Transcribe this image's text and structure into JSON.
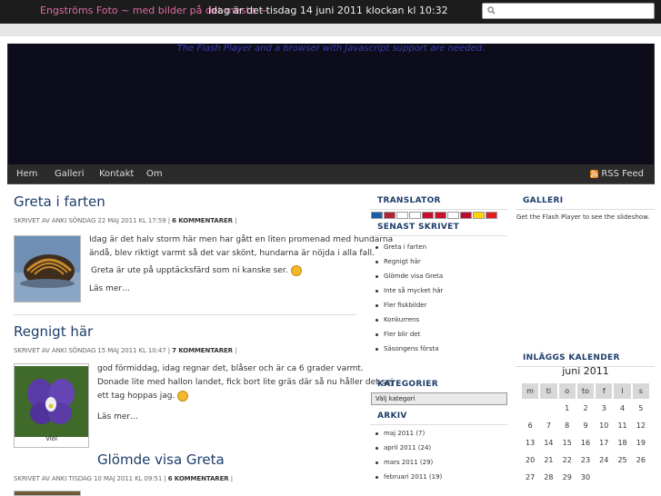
{
  "top": {
    "site_title": "Engströms Foto ~ med bilder på det mesta ~",
    "date_text": "idag är det tisdag 14 juni 2011 klockan kl 10:32",
    "search_placeholder": ""
  },
  "banner": {
    "message": "The Flash Player and a browser with Javascript support are needed."
  },
  "nav": {
    "items": [
      "Hem",
      "Galleri",
      "Kontakt",
      "Om"
    ],
    "rss": "RSS Feed"
  },
  "posts": [
    {
      "title": "Greta i farten",
      "meta_prefix": "SKRIVET AV ANKI SÖNDAG 22 MAJ 2011 KL 17:59 |",
      "comments": "6 KOMMENTARER",
      "meta_suffix": "|",
      "lines": [
        "Idag är det halv storm här men har gått en liten promenad med hundarna",
        "ändå, blev riktigt varmt så det var skönt, hundarna är nöjda i alla fall.",
        "Greta är ute på upptäcksfärd som ni kanske ser."
      ],
      "more": "Läs mer…"
    },
    {
      "title": "Regnigt här",
      "meta_prefix": "SKRIVET AV ANKI SÖNDAG 15 MAJ 2011 KL 10:47 |",
      "comments": "7 KOMMENTARER",
      "meta_suffix": "|",
      "lines": [
        "god förmiddag, idag regnar det, blåser och är ca 6 grader varmt.",
        "Donade lite med hallon landet, fick bort lite gräs där så nu håller det sej",
        "ett tag hoppas jag."
      ],
      "caption": "Viol",
      "more": "Läs mer…"
    },
    {
      "title": "Glömde visa Greta",
      "meta_prefix": "SKRIVET AV ANKI TISDAG 10 MAJ 2011 KL 09:51 |",
      "comments": "6 KOMMENTARER",
      "meta_suffix": "|"
    }
  ],
  "sidebar": {
    "translator_title": "TRANSLATOR",
    "latest_title": "SENAST SKRIVET",
    "latest": [
      "Greta i farten",
      "Regnigt här",
      "Glömde visa Greta",
      "Inte så mycket här",
      "Fler fiskbilder",
      "Konkurrens",
      "Fler blir det",
      "Säsongens första"
    ],
    "categories_title": "KATEGORIER",
    "categories_select": "Välj kategori",
    "archive_title": "ARKIV",
    "archive": [
      "maj 2011 (7)",
      "april 2011 (24)",
      "mars 2011 (29)",
      "februari 2011 (19)"
    ]
  },
  "gallery": {
    "title": "GALLERI",
    "message": "Get the Flash Player to see the slideshow."
  },
  "calendar": {
    "title": "INLÄGGS KALENDER",
    "month": "juni 2011",
    "days": [
      "m",
      "ti",
      "o",
      "to",
      "f",
      "l",
      "s"
    ],
    "weeks": [
      [
        "",
        "",
        "1",
        "2",
        "3",
        "4",
        "5"
      ],
      [
        "6",
        "7",
        "8",
        "9",
        "10",
        "11",
        "12"
      ],
      [
        "13",
        "14",
        "15",
        "16",
        "17",
        "18",
        "19"
      ],
      [
        "20",
        "21",
        "22",
        "23",
        "24",
        "25",
        "26"
      ],
      [
        "27",
        "28",
        "29",
        "30",
        "",
        "",
        ""
      ]
    ]
  }
}
